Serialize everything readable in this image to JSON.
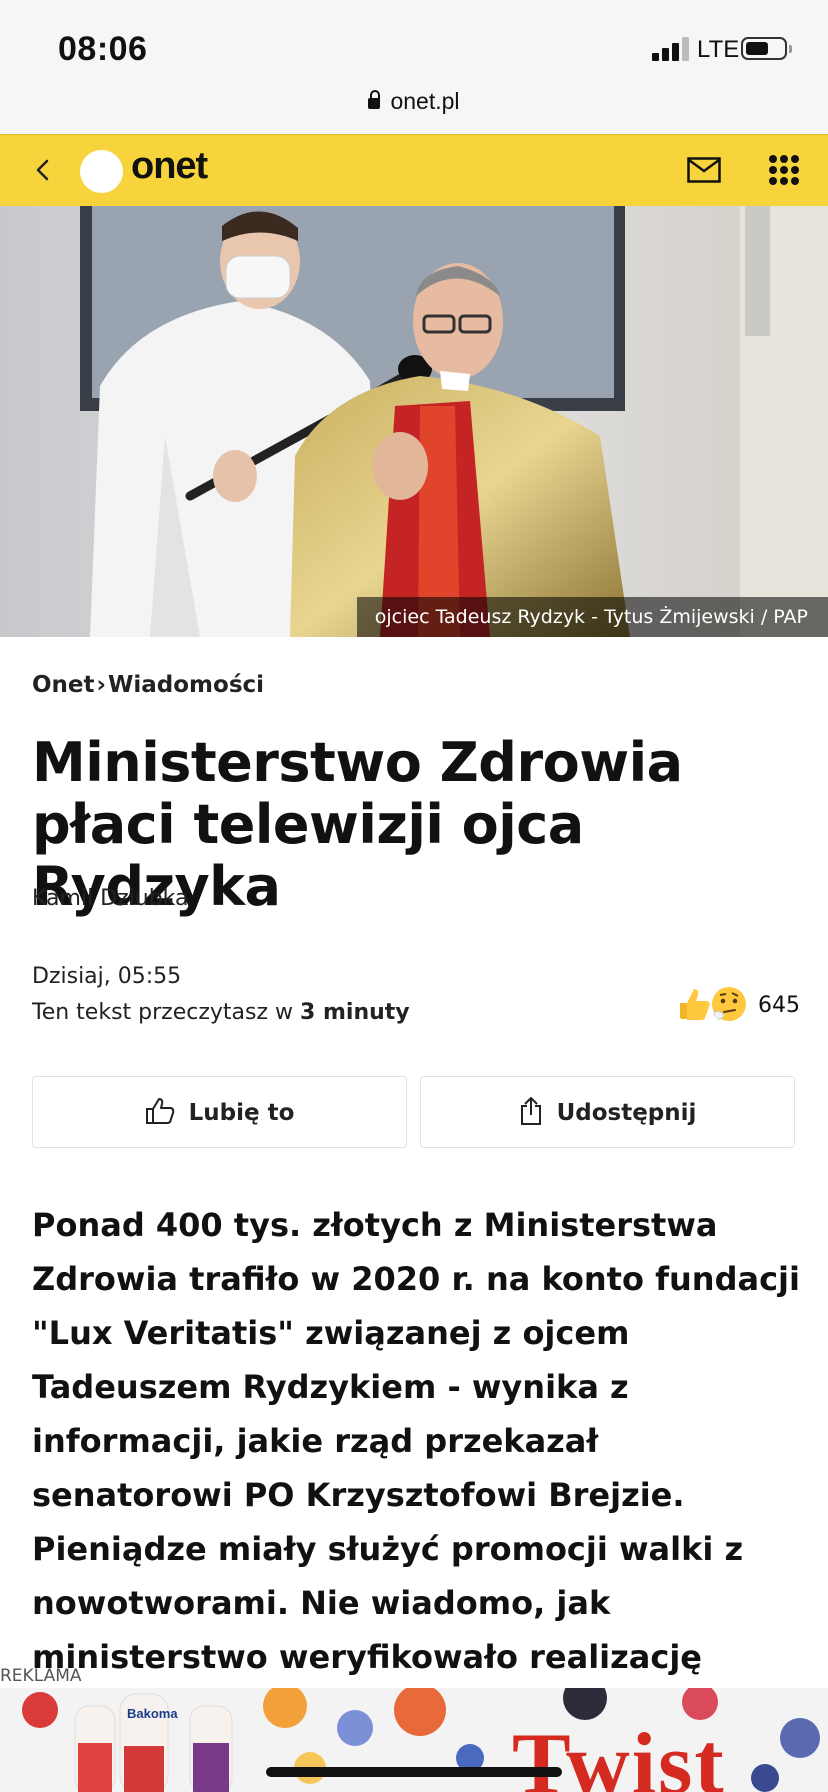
{
  "status_bar": {
    "time": "08:06",
    "network": "LTE"
  },
  "browser": {
    "url": "onet.pl"
  },
  "nav": {
    "logo_text": "onet"
  },
  "hero": {
    "caption": "ojciec Tadeusz Rydzyk - Tytus Żmijewski / PAP"
  },
  "breadcrumb": {
    "site": "Onet",
    "separator": "›",
    "section": "Wiadomości"
  },
  "article": {
    "headline": "Ministerstwo Zdrowia płaci telewizji ojca Rydzyka",
    "author": "Kamil Dziubka",
    "date": "Dzisiaj, 05:55",
    "read_time_prefix": "Ten tekst przeczytasz w ",
    "read_time_value": "3 minuty",
    "reactions_count": "645",
    "lead": "Ponad 400 tys. złotych z Ministerstwa Zdrowia trafiło w 2020 r. na konto fundacji \"Lux Veritatis\" związanej z ojcem Tadeuszem Rydzykiem - wynika z informacji, jakie rząd przekazał senatorowi PO Krzysztofowi Brejzie. Pieniądze miały służyć promocji walki z nowotworami. Nie wiadomo, jak ministerstwo weryfikowało realizację umowy."
  },
  "actions": {
    "like_label": "Lubię to",
    "share_label": "Udostępnij"
  },
  "ad": {
    "label": "REKLAMA",
    "brand_text": "Twist",
    "product_text": "Bakoma"
  },
  "colors": {
    "nav_yellow": "#f7d43b",
    "ad_red": "#d42a20"
  }
}
